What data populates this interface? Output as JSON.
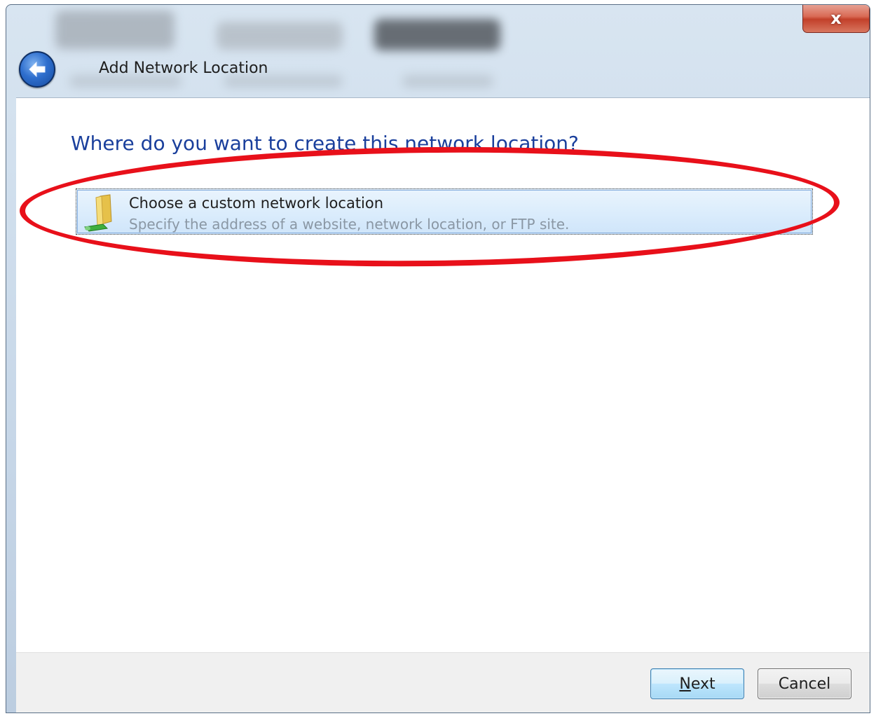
{
  "window": {
    "title": "Add Network Location",
    "close_label": "x"
  },
  "page": {
    "heading": "Where do you want to create this network location?"
  },
  "option": {
    "title": "Choose a custom network location",
    "description": "Specify the address of a website, network location, or FTP site.",
    "icon": "network-folder-icon"
  },
  "buttons": {
    "next_mnemonic": "N",
    "next_rest": "ext",
    "cancel_label": "Cancel"
  },
  "annotation": {
    "color": "#e8101a"
  },
  "colors": {
    "heading": "#1a3f9c",
    "description": "#8a97a4",
    "next_border": "#3c7fb1"
  }
}
